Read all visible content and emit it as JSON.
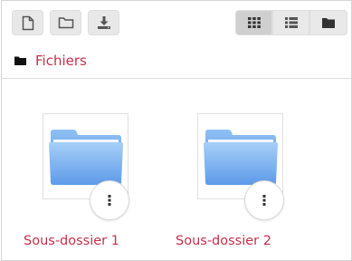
{
  "toolbar": {
    "buttons": [
      {
        "icon": "new-file-icon"
      },
      {
        "icon": "new-folder-icon"
      },
      {
        "icon": "download-icon"
      }
    ],
    "view_buttons": [
      {
        "icon": "grid-view-icon",
        "active": true
      },
      {
        "icon": "list-view-icon",
        "active": false
      },
      {
        "icon": "tree-view-icon",
        "active": false
      }
    ]
  },
  "breadcrumb": {
    "icon": "folder-icon",
    "label": "Fichiers"
  },
  "items": [
    {
      "name": "Sous-dossier 1",
      "icon": "folder-icon",
      "menu_icon": "more-options-icon"
    },
    {
      "name": "Sous-dossier 2",
      "icon": "folder-icon",
      "menu_icon": "more-options-icon"
    }
  ],
  "colors": {
    "link": "#c4314b",
    "folder_blue": "#6aa3ec",
    "button_bg": "#e8e8e8",
    "button_active_bg": "#cfcfcf"
  }
}
